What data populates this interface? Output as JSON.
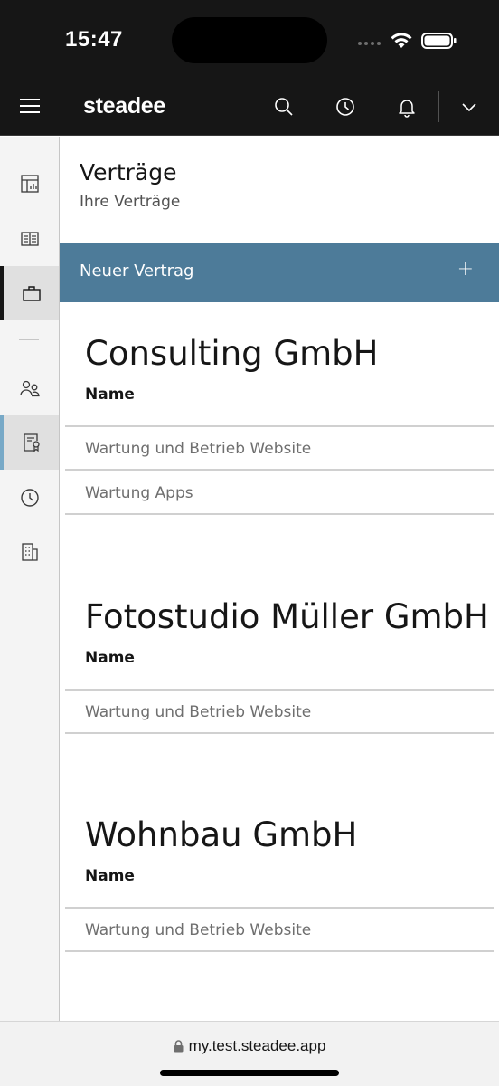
{
  "status_bar": {
    "time": "15:47",
    "icons": [
      "signal-icon",
      "wifi-icon",
      "battery-icon"
    ]
  },
  "header": {
    "brand": "steadee",
    "icons": [
      "menu-icon",
      "search-icon",
      "history-clock-icon",
      "notification-bell-icon",
      "chevron-down-icon"
    ]
  },
  "sidebar": {
    "items": [
      {
        "icon": "dashboard-icon",
        "active": false
      },
      {
        "icon": "document-list-icon",
        "active": false
      },
      {
        "icon": "briefcase-icon",
        "active": true
      },
      {
        "icon": "users-icon",
        "active": false
      },
      {
        "icon": "contract-certificate-icon",
        "active": true
      },
      {
        "icon": "time-clock-icon",
        "active": false
      },
      {
        "icon": "building-icon",
        "active": false
      }
    ]
  },
  "page": {
    "title": "Verträge",
    "subtitle": "Ihre Verträge",
    "new_button_label": "Neuer Vertrag",
    "new_button_icon": "+"
  },
  "groups": [
    {
      "company": "Consulting GmbH",
      "column_header": "Name",
      "contracts": [
        "Wartung und Betrieb Website",
        "Wartung Apps"
      ]
    },
    {
      "company": "Fotostudio Müller GmbH",
      "column_header": "Name",
      "contracts": [
        "Wartung und Betrieb Website"
      ]
    },
    {
      "company": "Wohnbau GmbH",
      "column_header": "Name",
      "contracts": [
        "Wartung und Betrieb Website"
      ]
    }
  ],
  "browser": {
    "url": "my.test.steadee.app"
  },
  "colors": {
    "header_bg": "#161616",
    "accent": "#4d7b99",
    "sidebar_bg": "#f4f4f4",
    "active_indicator": "#78a9c7"
  }
}
